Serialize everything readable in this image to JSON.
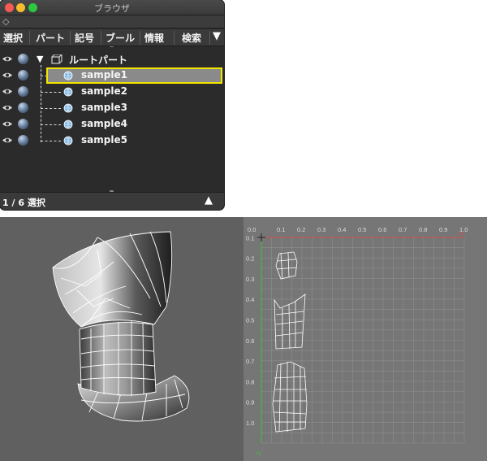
{
  "window": {
    "title": "ブラウザ",
    "menu": [
      "選択",
      "パート",
      "記号",
      "ブール",
      "情報",
      "検索"
    ],
    "root_label": "ルートパート",
    "items": [
      "sample1",
      "sample2",
      "sample3",
      "sample4",
      "sample5"
    ],
    "selected_index": 0,
    "status": "1 / 6 選択"
  },
  "uv_editor": {
    "u_ticks": [
      "0.0",
      "0.1",
      "0.2",
      "0.3",
      "0.4",
      "0.5",
      "0.6",
      "0.7",
      "0.8",
      "0.9",
      "1.0"
    ],
    "v_ticks": [
      "0.1",
      "0.2",
      "0.3",
      "0.4",
      "0.5",
      "0.6",
      "0.7",
      "0.8",
      "0.9",
      "1.0"
    ],
    "u_axis_label": "+u",
    "v_axis_label": "+V"
  },
  "colors": {
    "selection_outline": "#f3e600",
    "selected_row_bg": "#8a8a8a",
    "panel_bg": "#2b2b2b",
    "uv_u_axis": "#d05050",
    "uv_v_axis": "#40c040"
  }
}
